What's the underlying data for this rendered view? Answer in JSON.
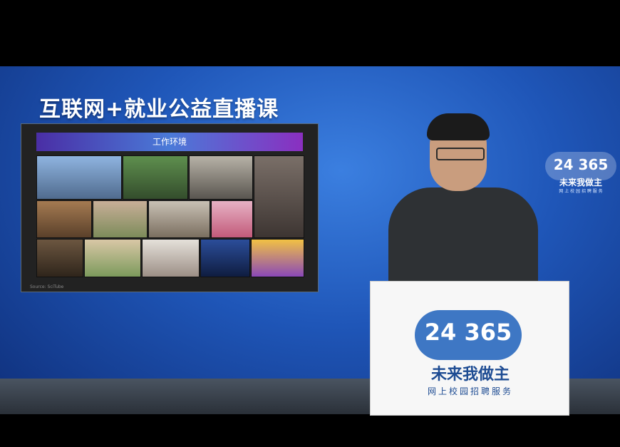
{
  "broadcast": {
    "title": "互联网+就业公益直播课",
    "panel_heading": "工作环境",
    "panel_caption": "Source: SciTube",
    "sign_number": "24 365",
    "sign_main": "未来我做主",
    "sign_sub": "网上校园招聘服务",
    "logo_number": "24 365",
    "logo_main": "未来我做主",
    "logo_sub": "网 上 校 园 招 聘 服 务"
  }
}
